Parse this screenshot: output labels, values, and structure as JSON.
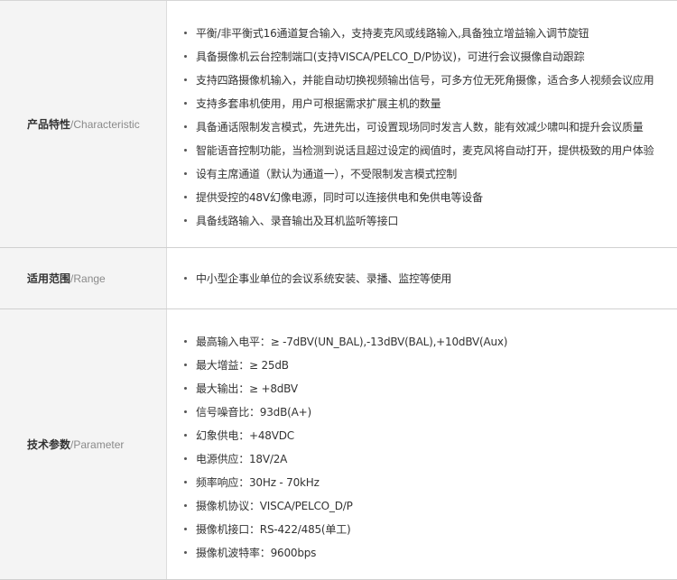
{
  "sections": {
    "characteristic": {
      "label_cn": "产品特性",
      "label_en": "/Characteristic",
      "items": [
        "平衡/非平衡式16通道复合输入，支持麦克风或线路输入,具备独立增益输入调节旋钮",
        "具备摄像机云台控制端口(支持VISCA/PELCO_D/P协议)，可进行会议摄像自动跟踪",
        "支持四路摄像机输入，并能自动切换视频输出信号，可多方位无死角摄像，适合多人视频会议应用",
        "支持多套串机使用，用户可根据需求扩展主机的数量",
        "具备通话限制发言模式，先进先出，可设置现场同时发言人数，能有效减少啸叫和提升会议质量",
        "智能语音控制功能，当检测到说话且超过设定的阀值时，麦克风将自动打开，提供极致的用户体验",
        "设有主席通道（默认为通道一），不受限制发言模式控制",
        "提供受控的48V幻像电源，同时可以连接供电和免供电等设备",
        "具备线路输入、录音输出及耳机监听等接口"
      ]
    },
    "range": {
      "label_cn": "适用范围",
      "label_en": "/Range",
      "items": [
        "中小型企事业单位的会议系统安装、录播、监控等使用"
      ]
    },
    "parameter": {
      "label_cn": "技术参数",
      "label_en": "/Parameter",
      "items": [
        "最高输入电平：≥ -7dBV(UN_BAL),-13dBV(BAL),+10dBV(Aux)",
        "最大增益：≥ 25dB",
        "最大输出：≥ +8dBV",
        "信号噪音比：93dB(A+)",
        "幻象供电：+48VDC",
        "电源供应：18V/2A",
        "频率响应：30Hz - 70kHz",
        "摄像机协议：VISCA/PELCO_D/P",
        "摄像机接口：RS-422/485(单工)",
        "摄像机波特率：9600bps"
      ]
    }
  }
}
